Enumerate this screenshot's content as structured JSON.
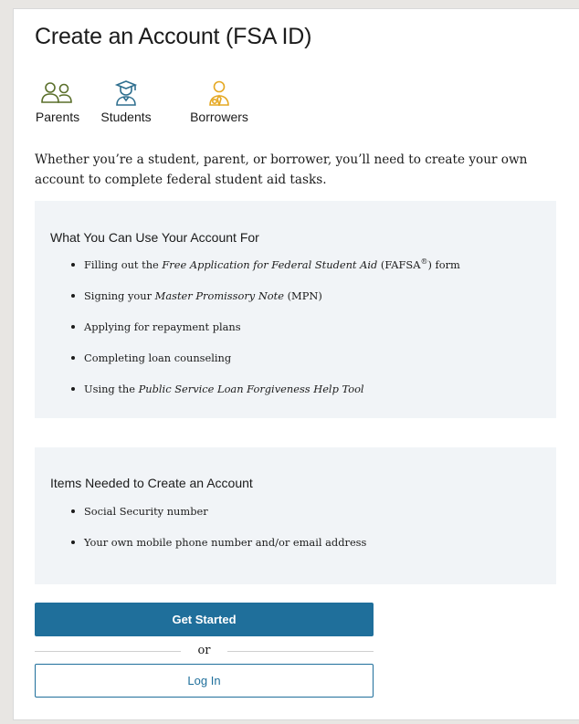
{
  "page": {
    "title": "Create an Account (FSA ID)"
  },
  "roles": [
    {
      "label": "Parents",
      "icon": "parents-icon",
      "color": "#5a6f2a"
    },
    {
      "label": "Students",
      "icon": "graduate-icon",
      "color": "#2f6f8f"
    },
    {
      "label": "Borrowers",
      "icon": "borrower-icon",
      "color": "#e5a823"
    }
  ],
  "intro": {
    "text": "Whether you’re a student, parent, or borrower, you’ll need to create your own account to complete federal student aid tasks."
  },
  "uses_box": {
    "heading": "What You Can Use Your Account For",
    "items": [
      {
        "pre": "Filling out the ",
        "em": "Free Application for Federal Student Aid",
        "post": " (FAFSA",
        "sup": "®",
        "post2": ") form"
      },
      {
        "pre": "Signing your ",
        "em": "Master Promissory Note",
        "post": " (MPN)"
      },
      {
        "pre": "Applying for repayment plans"
      },
      {
        "pre": "Completing loan counseling"
      },
      {
        "pre": "Using the ",
        "em": "Public Service Loan Forgiveness Help Tool"
      }
    ]
  },
  "needed_box": {
    "heading": "Items Needed to Create an Account",
    "items": [
      {
        "pre": "Social Security number"
      },
      {
        "pre": "Your own mobile phone number and/or email address"
      }
    ]
  },
  "actions": {
    "get_started_label": "Get Started",
    "divider_text": "or",
    "login_label": "Log In"
  },
  "colors": {
    "primary": "#1f6f9b",
    "box_bg": "#f1f4f7"
  }
}
